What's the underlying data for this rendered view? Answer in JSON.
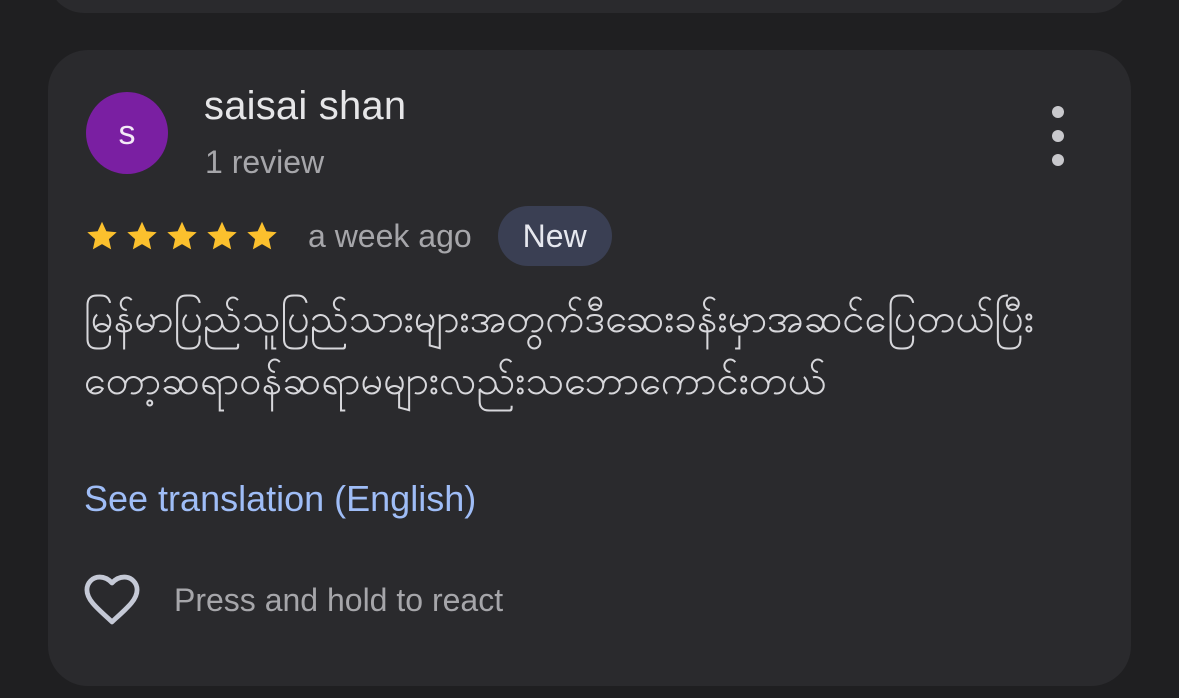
{
  "review": {
    "reviewer_name": "saisai shan",
    "avatar_initial": "s",
    "review_count": "1 review",
    "rating": 5,
    "rating_max": 5,
    "date": "a week ago",
    "badge": "New",
    "text": "မြန်မာပြည်သူပြည်သားများအတွက်ဒီဆေးခန်းမှာအဆင်ပြေတယ်ပြီးတော့ဆရာဝန်ဆရာမများလည်းသဘောကောင်းတယ်",
    "translate_link": "See translation (English)",
    "react_hint": "Press and hold to react"
  },
  "icons": {
    "more": "more-vert-icon",
    "star": "star-icon",
    "heart": "heart-outline-icon"
  },
  "colors": {
    "avatar_bg": "#7a1fa2",
    "star": "#fbc02d",
    "link": "#9fbdf7",
    "badge_bg": "#3a3f53"
  }
}
